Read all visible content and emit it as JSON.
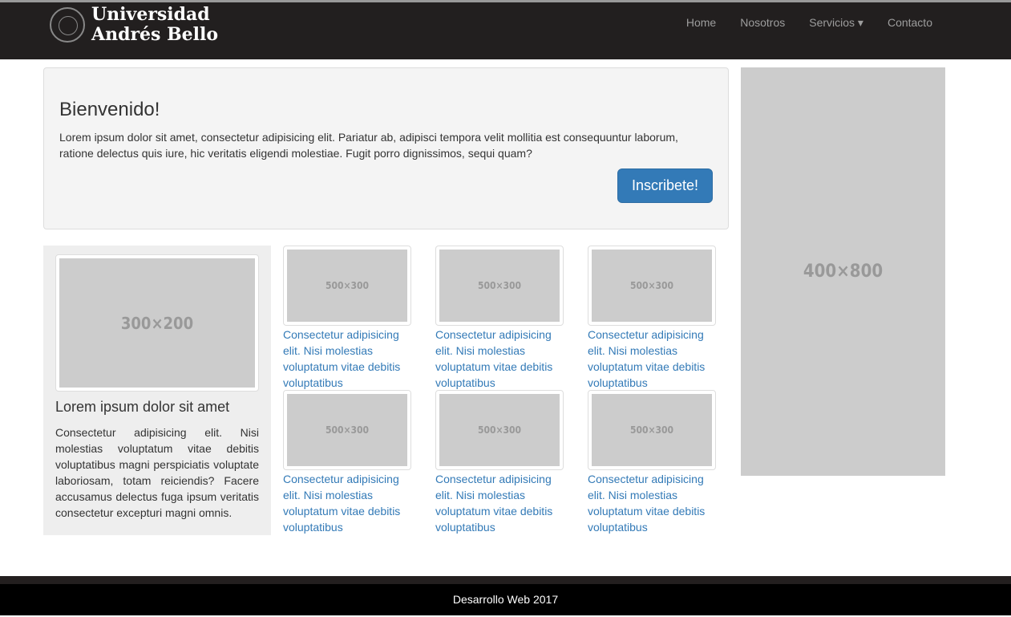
{
  "nav": {
    "brand_line1": "Universidad",
    "brand_line2": "Andrés Bello",
    "items": [
      "Home",
      "Nosotros",
      "Servicios",
      "Contacto"
    ],
    "dropdown_caret": "▾"
  },
  "jumbotron": {
    "title": "Bienvenido!",
    "text": "Lorem ipsum dolor sit amet, consectetur adipisicing elit. Pariatur ab, adipisci tempora velit mollitia est consequuntur laborum, ratione delectus quis iure, hic veritatis eligendi molestiae. Fugit porro dignissimos, sequi quam?",
    "button": "Inscribete!"
  },
  "side_placeholder": "400×800",
  "card": {
    "image": "300×200",
    "title": "Lorem ipsum dolor sit amet",
    "text": "Consectetur adipisicing elit. Nisi molestias voluptatum vitae debitis voluptatibus magni perspiciatis voluptate laboriosam, totam reiciendis? Facere accusamus delectus fuga ipsum veritatis consectetur excepturi magni omnis."
  },
  "tiles": [
    {
      "image": "500×300",
      "link": "Consectetur adipisicing elit. Nisi molestias voluptatum vitae debitis voluptatibus"
    },
    {
      "image": "500×300",
      "link": "Consectetur adipisicing elit. Nisi molestias voluptatum vitae debitis voluptatibus"
    },
    {
      "image": "500×300",
      "link": "Consectetur adipisicing elit. Nisi molestias voluptatum vitae debitis voluptatibus"
    },
    {
      "image": "500×300",
      "link": "Consectetur adipisicing elit. Nisi molestias voluptatum vitae debitis voluptatibus"
    },
    {
      "image": "500×300",
      "link": "Consectetur adipisicing elit. Nisi molestias voluptatum vitae debitis voluptatibus"
    },
    {
      "image": "500×300",
      "link": "Consectetur adipisicing elit. Nisi molestias voluptatum vitae debitis voluptatibus"
    }
  ],
  "footer": "Desarrollo Web 2017"
}
